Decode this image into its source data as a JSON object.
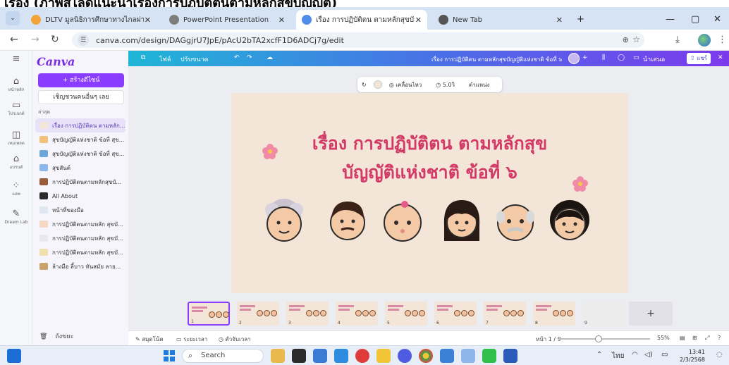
{
  "cropped_heading": "เร่อง (ภาพสไลด์แนะนำเรื่องการปฏิบัติตนตามหลักสุขบัญญัติ)",
  "browser": {
    "tabs": [
      {
        "label": "DLTV มูลนิธิการศึกษาทางไกลผ่านดาวเทียม"
      },
      {
        "label": "PowerPoint Presentation"
      },
      {
        "label": "เรื่อง การปฏิบัติตน ตามหลักสุขบัญญัติ"
      },
      {
        "label": "New Tab"
      }
    ],
    "url": "canva.com/design/DAGgjrU7JpE/pAcU2bTA2xcfF1D6ADCj7g/edit",
    "icons": [
      "back-icon",
      "forward-icon",
      "reload-icon",
      "zoom-icon",
      "star-icon",
      "download-icon",
      "menu-icon"
    ]
  },
  "canva": {
    "logo": "Canva",
    "rail": [
      {
        "icon": "⌂",
        "label": "หน้าหลัก"
      },
      {
        "icon": "▭",
        "label": "โปรเจกต์"
      },
      {
        "icon": "◫",
        "label": "เทมเพลต"
      },
      {
        "icon": "⌂",
        "label": "แบรนด์"
      },
      {
        "icon": "⁘",
        "label": "แอพ"
      },
      {
        "icon": "✎",
        "label": "Dream Lab"
      }
    ],
    "create_button": "+ สร้างดีไซน์",
    "invite_button": "เชิญชวนคนอื่นๆ เลย",
    "recent_label": "ล่าสุด",
    "recent_items": [
      {
        "label": "เรื่อง การปฏิบัติตน ตามหลัก...",
        "color": "#f3e5d8"
      },
      {
        "label": "สุขบัญญัติแห่งชาติ ข้อที่ สุข...",
        "color": "#f0c27a"
      },
      {
        "label": "สุขบัญญัติแห่งชาติ ข้อที่ สุข...",
        "color": "#6aa6d8"
      },
      {
        "label": "สุขสันต์",
        "color": "#8bb8e8"
      },
      {
        "label": "การปฏิบัติตนตามหลักสุขบั...",
        "color": "#9a5b3a"
      },
      {
        "label": "All About",
        "color": "#2a2a2a"
      },
      {
        "label": "หน้าที่ของมือ",
        "color": "#dfe8f2"
      },
      {
        "label": "การปฏิบัติตนตามหลัก สุขบั...",
        "color": "#f6d9c4"
      },
      {
        "label": "การปฏิบัติตนตามหลัก สุขบั...",
        "color": "#e8e8f2"
      },
      {
        "label": "การปฏิบัติตนตามหลัก สุขบั...",
        "color": "#f2dfae"
      },
      {
        "label": "ล้างมือ ลี้บาว ทันสมัย ลาย...",
        "color": "#c8a46a"
      }
    ],
    "trash": "ถังขยะ",
    "topbar": {
      "file": "ไฟล์",
      "resize": "ปรับขนาด",
      "doc_title": "เรื่อง การปฏิบัติตน ตามหลักสุขบัญญัติแห่งชาติ ข้อที่ ๖",
      "present": "นำเสนอ",
      "share": "แชร์"
    },
    "float_toolbar": {
      "animate": "เคลื่อนไหว",
      "duration": "5.0วิ",
      "position": "ตำแหน่ง"
    },
    "slide": {
      "title_line1": "เรื่อง การปฏิบัติตน ตามหลักสุข",
      "title_line2": "บัญญัติแห่งชาติ ข้อที่ ๖",
      "title_color": "#d23a67",
      "background": "#f3e5d8"
    },
    "thumbnails": [
      {
        "num": "1"
      },
      {
        "num": "2"
      },
      {
        "num": "3"
      },
      {
        "num": "4"
      },
      {
        "num": "5"
      },
      {
        "num": "6"
      },
      {
        "num": "7"
      },
      {
        "num": "8"
      },
      {
        "num": "9"
      }
    ],
    "add_page": "+",
    "bottombar": {
      "notes": "สมุดโน้ต",
      "duration": "ระยะเวลา",
      "timer": "ตัวจับเวลา",
      "page": "หน้า 1 / 9",
      "zoom": "55%"
    }
  },
  "taskbar": {
    "search": "Search",
    "lang": "ไทย",
    "time": "13:41",
    "date": "2/3/2568"
  }
}
